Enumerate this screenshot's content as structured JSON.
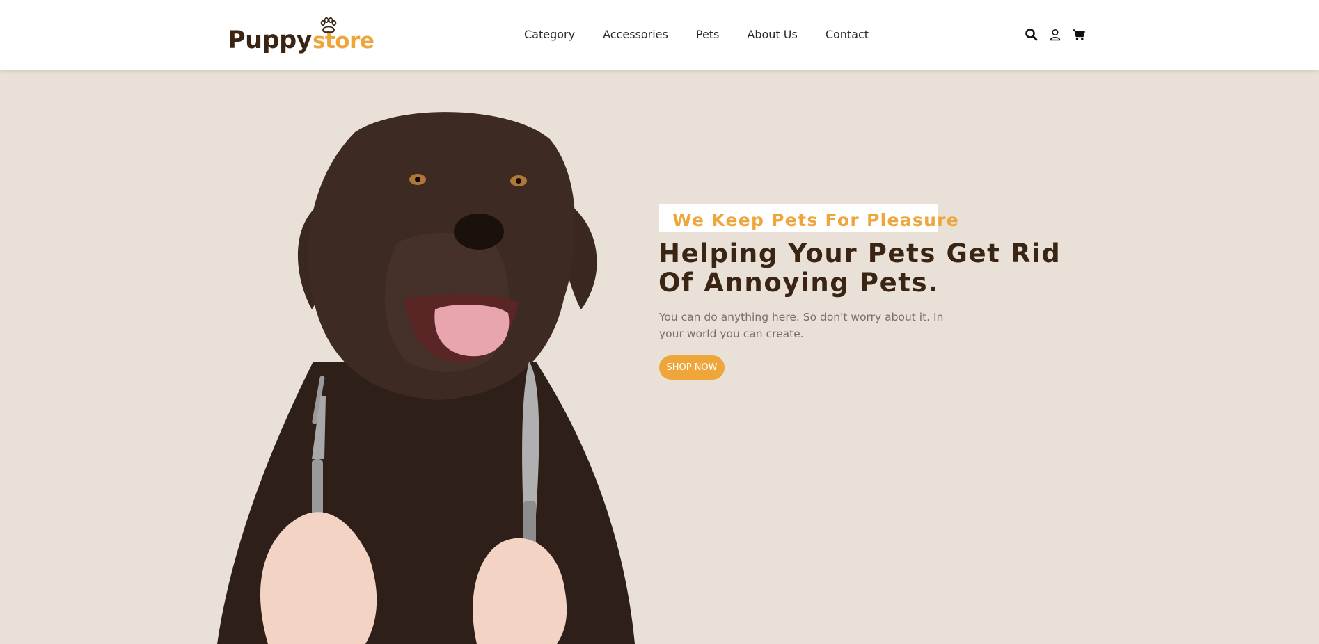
{
  "header": {
    "logo": {
      "part1": "Puppy",
      "part2": "store"
    },
    "nav": [
      {
        "label": "Category"
      },
      {
        "label": "Accessories"
      },
      {
        "label": "Pets"
      },
      {
        "label": "About Us"
      },
      {
        "label": "Contact"
      }
    ],
    "icons": [
      "search-icon",
      "user-icon",
      "cart-icon"
    ]
  },
  "hero": {
    "tagline": "We Keep Pets For Pleasure",
    "headline": "Helping Your Pets Get Rid Of Annoying Pets.",
    "subtext": "You can do anything here. So don't worry about it. In your world you can create.",
    "cta_label": "SHOP NOW"
  },
  "colors": {
    "accent": "#eea63a",
    "brand_dark": "#3a2414",
    "background": "#e9e1d7",
    "header_bg": "#ffffff"
  }
}
